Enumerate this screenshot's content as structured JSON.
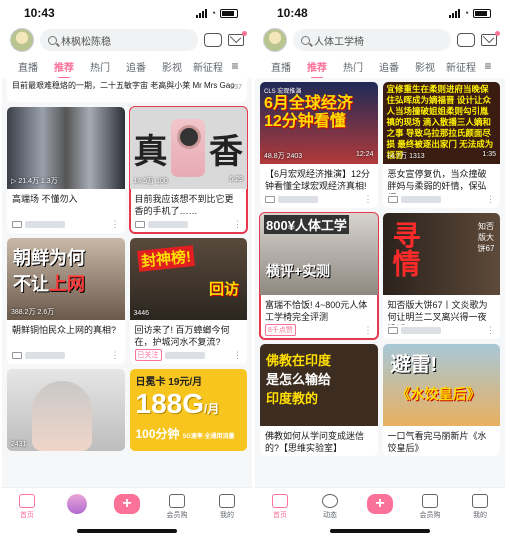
{
  "left": {
    "status_time": "10:43",
    "search_text": "林枫松陈稳",
    "tabs": [
      "直播",
      "推荐",
      "热门",
      "追番",
      "影视",
      "新征程"
    ],
    "top_strip": {
      "text": "目前最艰难稳烙的一期，二十五敏字宙 老高與小莱 Mr Mrs Gao",
      "likes": "237"
    },
    "cards": [
      {
        "plays": "21.4万",
        "comments": "1.3万",
        "duration": "",
        "title": "高端场 不懂勿入"
      },
      {
        "plays": "14.5万",
        "comments": "100",
        "duration": "6:29",
        "title": "目前我应该想不到比它更香的手机了……",
        "big_left": "真",
        "big_right": "香"
      },
      {
        "plays": "388.2万",
        "comments": "2.6万",
        "duration": "",
        "title": "朝鲜铜怕民众上网的真相?",
        "line1": "朝鲜为何",
        "line2a": "不让",
        "line2b": "上网"
      },
      {
        "plays": "3446",
        "comments": "",
        "duration": "",
        "title": "回访来了! 百万蟑螂今何在，护城河水不复流?",
        "badge": "已关注",
        "line1": "封神榜!",
        "line2": "回访"
      },
      {
        "plays": "2431",
        "comments": "",
        "duration": "",
        "title": ""
      },
      {
        "plays": "",
        "comments": "",
        "duration": "",
        "title": "",
        "a": "日冕卡 19元/月",
        "b": "188G",
        "b_unit": "/月",
        "c": "100分钟",
        "d": "5G速率 全通用流量"
      }
    ],
    "nav": [
      "首页",
      "",
      "",
      "会员购",
      "我的"
    ]
  },
  "right": {
    "status_time": "10:48",
    "search_text": "人体工学椅",
    "tabs": [
      "直播",
      "推荐",
      "热门",
      "追番",
      "影视",
      "新征程"
    ],
    "cards": [
      {
        "plays": "48.8万",
        "comments": "2403",
        "duration": "12:24",
        "title": "【6月宏观经济推演】12分钟看懂全球宏观经济真相!",
        "logo": "CLS 宏观推演",
        "line1": "6月全球经济",
        "line2": "12分钟看懂"
      },
      {
        "plays": "14.7万",
        "comments": "1313",
        "duration": "1:35",
        "title": "恶女宣停复仇，当众撞破胖妈与柔弱的奸情，保弘樨一……",
        "text": "宜修重生在柔则进府当晚保住弘晖成为嫡福晋 设计让众人当场撞破姐姐柔则勾引胤禛的现场 滴入散播三人嫡和之事 导致乌拉那拉氏颜面尽损 最终被逐出家门 无法成为福晋"
      },
      {
        "plays": "",
        "comments": "",
        "duration": "",
        "title": "富瑞不恰饭! 4~800元人体工学椅完全评测",
        "badge": "8千点赞",
        "line1": "800¥人体工学",
        "line2": "横评+实测"
      },
      {
        "plays": "",
        "comments": "",
        "duration": "",
        "title": "知否版大饼67丨文炎歌为何让明兰二叉离兴得一夜没睡",
        "v": "寻情",
        "n": "知否版大饼67"
      },
      {
        "plays": "",
        "comments": "",
        "duration": "",
        "title": "佛教如何从学问变成迷信的?【思维实验室】",
        "l1": "佛教在印度",
        "l2": "是怎么输给",
        "l3": "印度教的"
      },
      {
        "plays": "",
        "comments": "",
        "duration": "",
        "title": "一口气看完马丽新片《水饺皇后》",
        "l1": "避雷!",
        "l2": "《水饺皇后》"
      }
    ],
    "nav": [
      "首页",
      "动态",
      "",
      "会员购",
      "我的"
    ]
  }
}
